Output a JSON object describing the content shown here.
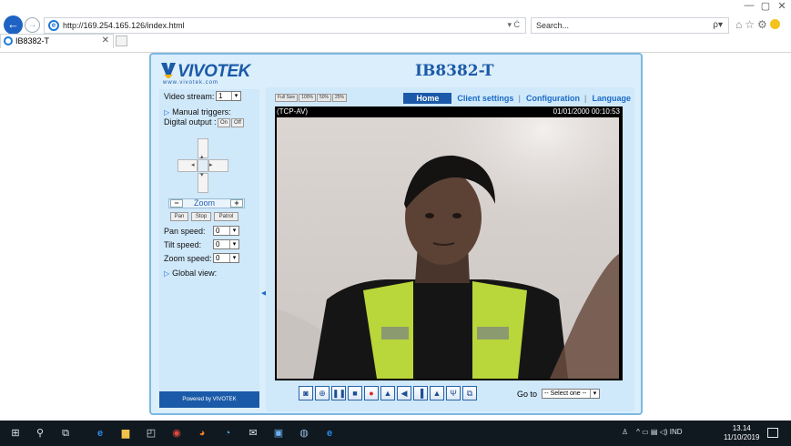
{
  "browser": {
    "window_controls": [
      "—",
      "▢",
      "✕"
    ],
    "url": "http://169.254.165.126/index.html",
    "address_icons": "▾ Ċ",
    "search_placeholder": "Search...",
    "search_icon": "ρ▾",
    "tab_title": "IB8382-T",
    "tab_close": "✕"
  },
  "header": {
    "logo_text": "VIVOTEK",
    "logo_sub": "www.vivotek.com",
    "model": "IB8382-T"
  },
  "left_panel": {
    "video_stream_label": "Video stream:",
    "video_stream_value": "1",
    "manual_triggers_label": "Manual triggers:",
    "digital_output_label": "Digital output :",
    "digital_output_on": "On",
    "digital_output_off": "Off",
    "zoom_label": "Zoom",
    "zoom_minus": "−",
    "zoom_plus": "+",
    "pan_btn": "Pan",
    "stop_btn": "Stop",
    "patrol_btn": "Patrol",
    "pan_speed_label": "Pan speed:",
    "pan_speed_value": "0",
    "tilt_speed_label": "Tilt speed:",
    "tilt_speed_value": "0",
    "zoom_speed_label": "Zoom speed:",
    "zoom_speed_value": "0",
    "global_view_label": "Global view:",
    "powered_by": "Powered by VIVOTEK"
  },
  "view": {
    "sizes": [
      "Full Size",
      "100%",
      "50%",
      "25%"
    ],
    "nav": {
      "home": "Home",
      "client_settings": "Client settings",
      "configuration": "Configuration",
      "language": "Language"
    },
    "protocol": "(TCP-AV)",
    "timestamp": "01/01/2000 00:10:53",
    "goto_label": "Go to",
    "goto_value": "-- Select one --"
  },
  "controls": [
    {
      "icon": "camera-icon",
      "glyph": "◙"
    },
    {
      "icon": "digital-zoom-icon",
      "glyph": "⊕"
    },
    {
      "icon": "pause-icon",
      "glyph": "❚❚"
    },
    {
      "icon": "stop-icon",
      "glyph": "■"
    },
    {
      "icon": "record-icon",
      "glyph": "●"
    },
    {
      "icon": "talk-icon",
      "glyph": "▲"
    },
    {
      "icon": "speaker-icon",
      "glyph": "◀"
    },
    {
      "icon": "volume-icon",
      "glyph": "▐"
    },
    {
      "icon": "mic-icon",
      "glyph": "▲"
    },
    {
      "icon": "ptz-icon",
      "glyph": "Ψ"
    },
    {
      "icon": "fullscreen-icon",
      "glyph": "⧉"
    }
  ],
  "taskbar": {
    "language": "IND",
    "time": "13.14",
    "date": "11/10/2019"
  },
  "colors": {
    "brand": "#1b5aa8",
    "panel_bg": "#dbeefb",
    "panel_border": "#7cb9e2",
    "taskbar": "#101820"
  }
}
